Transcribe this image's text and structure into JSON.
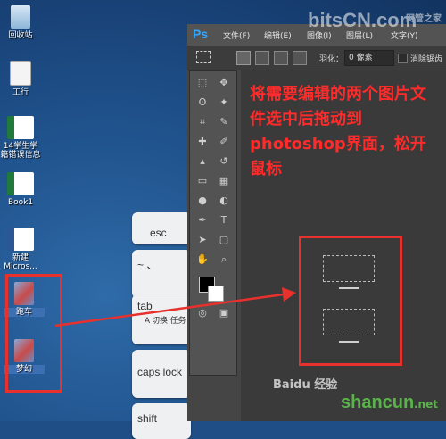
{
  "desktop": {
    "icons": [
      {
        "label": "回收站"
      },
      {
        "label": "工行"
      },
      {
        "label": "14学生学籍错误信息"
      },
      {
        "label": "Book1"
      },
      {
        "label": "新建 Micros..."
      },
      {
        "label": "跑车"
      },
      {
        "label": "梦幻"
      }
    ]
  },
  "keyboard": {
    "esc": "esc",
    "tilde": "~ 、",
    "tab": "tab",
    "tab_hint": "A 切换 任务",
    "caps": "caps lock",
    "shift": "shift"
  },
  "photoshop": {
    "logo": "Ps",
    "menu": [
      "文件(F)",
      "编辑(E)",
      "图像(I)",
      "图层(L)",
      "文字(Y)"
    ],
    "feather_label": "羽化：",
    "feather_value": "0 像素",
    "antialias_label": "消除锯齿"
  },
  "annotation": {
    "text": "将需要编辑的两个图片文件选中后拖动到photoshop界面，松开鼠标"
  },
  "watermarks": {
    "top_brand": "bitsCN.com",
    "top_sub": "网管之家",
    "bottom_brand": "shancun",
    "bottom_sub": "Baidu 经验",
    "bottom_suffix": ".net"
  }
}
